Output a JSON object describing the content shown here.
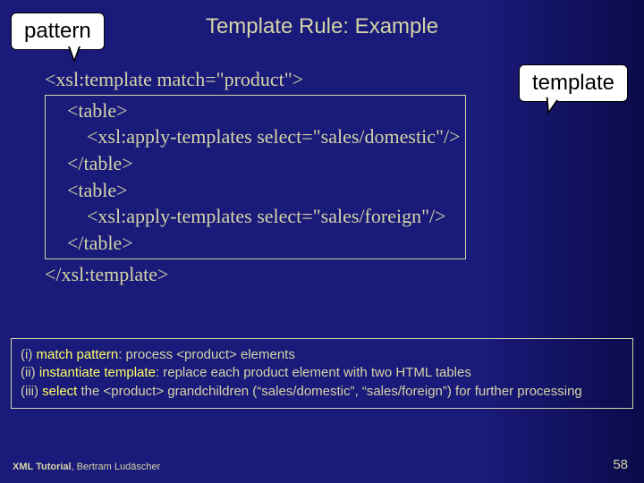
{
  "title": "Template Rule: Example",
  "callouts": {
    "pattern": "pattern",
    "template": "template"
  },
  "code": {
    "l1": "<xsl:template match=\"product\">",
    "l2": "<table>",
    "l3": "<xsl:apply-templates select=\"sales/domestic\"/>",
    "l4": "</table>",
    "l5": "<table>",
    "l6": "<xsl:apply-templates select=\"sales/foreign\"/>",
    "l7": "</table>",
    "l8": "</xsl:template>"
  },
  "notes": {
    "n1a": "(i) ",
    "n1b": "match pattern",
    "n1c": ": process <product> elements",
    "n2a": "(ii) ",
    "n2b": "instantiate template",
    "n2c": ": replace each product element with two HTML tables",
    "n3a": "(iii) ",
    "n3b": "select",
    "n3c": " the <product> grandchildren (“sales/domestic”, “sales/foreign”) for further processing"
  },
  "footer": {
    "title": "XML Tutorial",
    "author": ", Bertram Ludäscher",
    "page": "58"
  }
}
